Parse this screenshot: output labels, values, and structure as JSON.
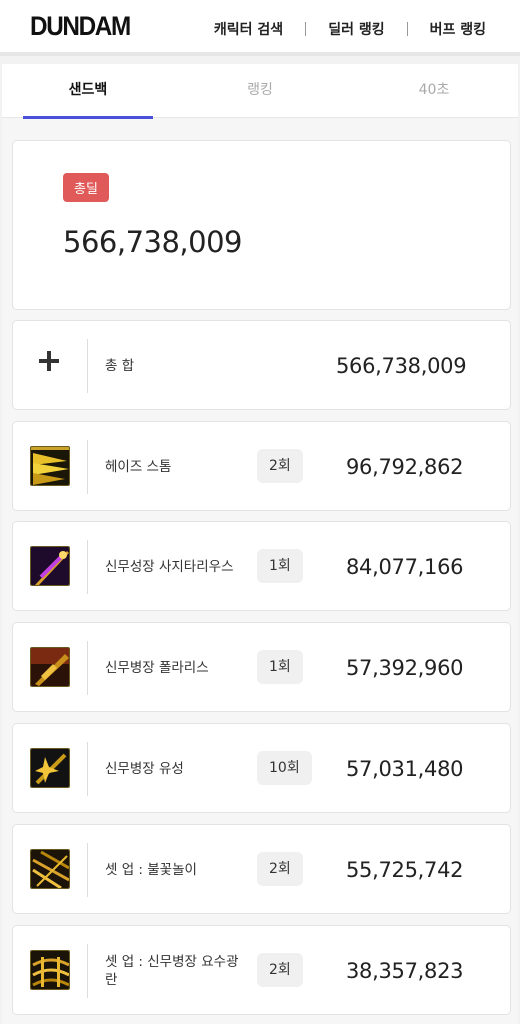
{
  "header": {
    "logo": "DUNDAM",
    "nav": [
      "캐릭터 검색",
      "딜러 랭킹",
      "버프 랭킹"
    ]
  },
  "tabs": [
    {
      "label": "샌드백",
      "active": true
    },
    {
      "label": "랭킹",
      "active": false
    },
    {
      "label": "40초",
      "active": false
    }
  ],
  "total": {
    "badge": "총딜",
    "value": "566,738,009"
  },
  "summary": {
    "label": "총 합",
    "value": "566,738,009",
    "icon": "plus-icon"
  },
  "skills": [
    {
      "name": "헤이즈 스톰",
      "hits": "2회",
      "damage": "96,792,862",
      "icon": "haze-storm-icon"
    },
    {
      "name": "신무성장 사지타리우스",
      "hits": "1회",
      "damage": "84,077,166",
      "icon": "sagittarius-icon"
    },
    {
      "name": "신무병장 폴라리스",
      "hits": "1회",
      "damage": "57,392,960",
      "icon": "polaris-icon"
    },
    {
      "name": "신무병장 유성",
      "hits": "10회",
      "damage": "57,031,480",
      "icon": "meteor-icon"
    },
    {
      "name": "셋 업 : 불꽃놀이",
      "hits": "2회",
      "damage": "55,725,742",
      "icon": "fireworks-icon"
    },
    {
      "name": "셋 업 : 신무병장 요수광란",
      "hits": "2회",
      "damage": "38,357,823",
      "icon": "frenzy-icon"
    }
  ],
  "colors": {
    "accent": "#4a4fd8",
    "badge": "#e05a5a"
  }
}
